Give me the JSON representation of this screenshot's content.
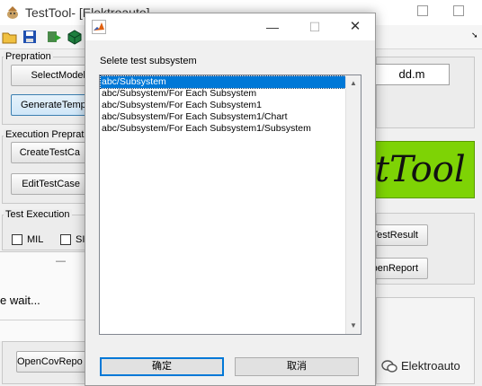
{
  "main_window": {
    "title": "TestTool- [Elektroauto]",
    "sections": {
      "prepration": {
        "title": "Prepration",
        "select_model": "SelectModel",
        "generate_template": "GenerateTempl",
        "model_file": "dd.m"
      },
      "execution_prepration": {
        "title": "Execution Prepration",
        "create_test_case": "CreateTestCa",
        "edit_test_case": "EditTestCase"
      },
      "logo_text": "tTool",
      "test_execution": {
        "title": "Test Execution",
        "mil_label": "MIL",
        "sil_label": "SI"
      },
      "results": {
        "open_test_result": "nTestResult",
        "open_report": "penReport"
      },
      "coverage": {
        "open_cov_report": "OpenCovRepo"
      }
    },
    "progress_dialog": {
      "minimize": "—",
      "text": "e wait..."
    },
    "colors": {
      "logo_bg": "#7ed305",
      "selection": "#0078d7"
    }
  },
  "dialog": {
    "title": "",
    "prompt": "Selete test subsystem",
    "items": [
      "abc/Subsystem",
      "abc/Subsystem/For Each Subsystem",
      "abc/Subsystem/For Each Subsystem1",
      "abc/Subsystem/For Each Subsystem1/Chart",
      "abc/Subsystem/For Each Subsystem1/Subsystem"
    ],
    "selected_index": 0,
    "ok_label": "确定",
    "cancel_label": "取消",
    "controls": {
      "minimize": "—",
      "maximize": "☐",
      "close": "✕"
    }
  },
  "watermark": {
    "text": "Elektroauto",
    "icon": "wechat-icon"
  }
}
